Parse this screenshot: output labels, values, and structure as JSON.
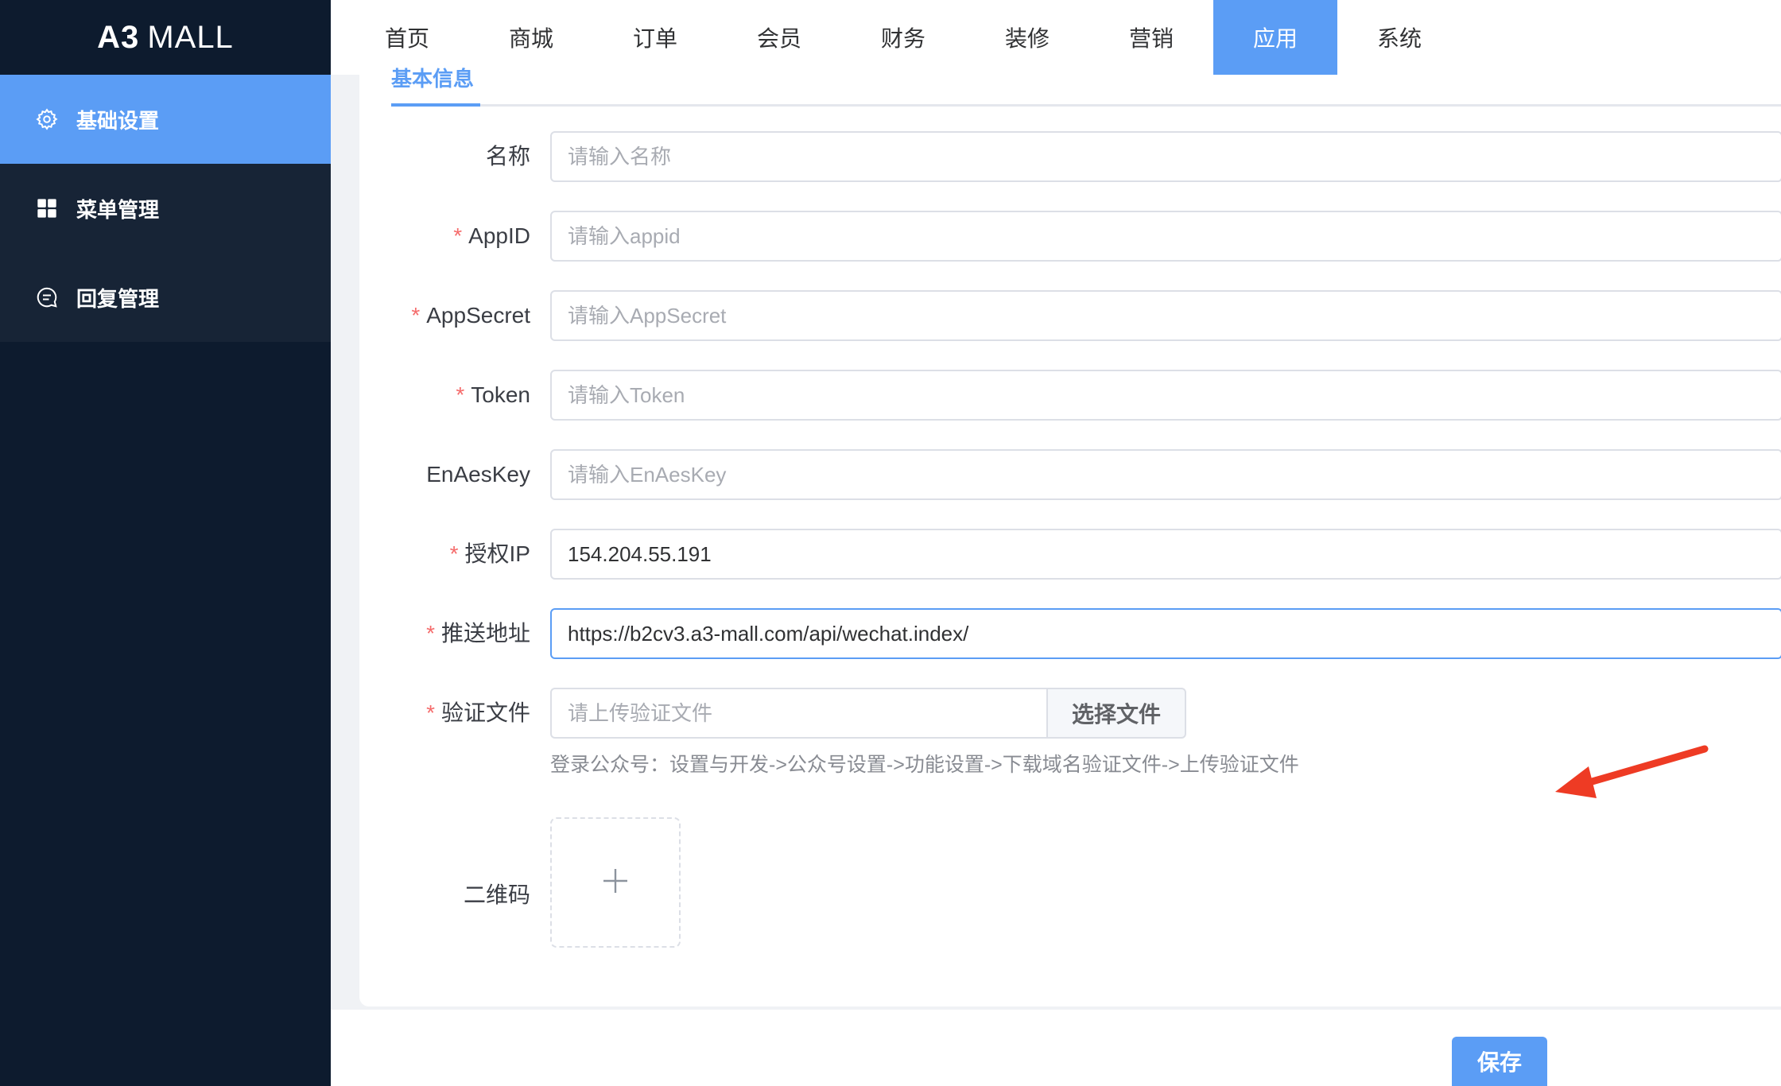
{
  "app": {
    "logo_bold": "A3",
    "logo_light": "MALL"
  },
  "sidebar": {
    "items": [
      {
        "label": "基础设置",
        "icon": "gear-icon",
        "active": true
      },
      {
        "label": "菜单管理",
        "icon": "grid-icon",
        "active": false
      },
      {
        "label": "回复管理",
        "icon": "chat-icon",
        "active": false
      }
    ]
  },
  "topnav": {
    "items": [
      "首页",
      "商城",
      "订单",
      "会员",
      "财务",
      "装修",
      "营销",
      "应用",
      "系统"
    ],
    "active": "应用"
  },
  "tab": {
    "label": "基本信息"
  },
  "form": {
    "name": {
      "label": "名称",
      "placeholder": "请输入名称",
      "value": ""
    },
    "appid": {
      "label": "AppID",
      "placeholder": "请输入appid",
      "value": ""
    },
    "appsecret": {
      "label": "AppSecret",
      "placeholder": "请输入AppSecret",
      "value": ""
    },
    "token": {
      "label": "Token",
      "placeholder": "请输入Token",
      "value": ""
    },
    "enaeskey": {
      "label": "EnAesKey",
      "placeholder": "请输入EnAesKey",
      "value": ""
    },
    "ip": {
      "label": "授权IP",
      "placeholder": "",
      "value": "154.204.55.191"
    },
    "push_url": {
      "label": "推送地址",
      "placeholder": "",
      "value": "https://b2cv3.a3-mall.com/api/wechat.index/"
    },
    "verify_file": {
      "label": "验证文件",
      "placeholder": "请上传验证文件",
      "button": "选择文件"
    },
    "hint": "登录公众号：设置与开发->公众号设置->功能设置->下载域名验证文件->上传验证文件",
    "qrcode": {
      "label": "二维码"
    },
    "required_mark": "*"
  },
  "footer": {
    "save_label": "保存"
  },
  "colors": {
    "accent": "#5b9df5",
    "sidebar_bg": "#0d1b2e",
    "required": "#f56c6c",
    "arrow": "#ee3b24"
  }
}
